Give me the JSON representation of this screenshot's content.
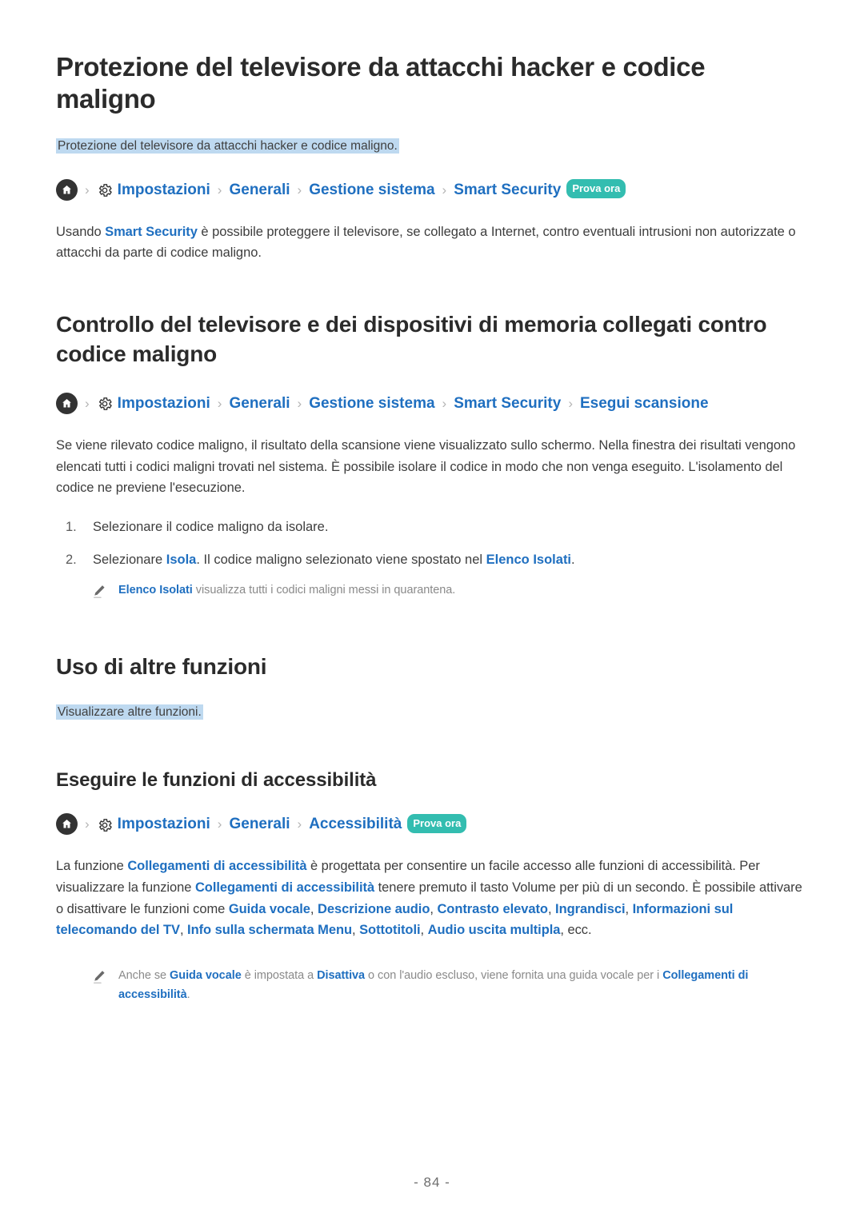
{
  "document": {
    "page_number": "- 84 -"
  },
  "icons": {
    "home": "home-icon",
    "gear": "gear-icon",
    "pencil": "pencil-icon",
    "separator": "›"
  },
  "colors": {
    "link": "#1f6fc0",
    "highlight": "#bed9f0",
    "badge": "#33bdb0",
    "heading": "#2b2b2b",
    "body": "#3d3d3d",
    "note": "#8a8a8a"
  },
  "labels": {
    "try_now": "Prova ora"
  },
  "sections": [
    {
      "id": "protezione",
      "title": "Protezione del televisore da attacchi hacker e codice maligno",
      "highlight": "Protezione del televisore da attacchi hacker e codice maligno.",
      "breadcrumb": {
        "items": [
          "Impostazioni",
          "Generali",
          "Gestione sistema",
          "Smart Security"
        ],
        "badge": "Prova ora"
      },
      "paragraph": {
        "before": "Usando ",
        "link": "Smart Security",
        "after": " è possibile proteggere il televisore, se collegato a Internet, contro eventuali intrusioni non autorizzate o attacchi da parte di codice maligno."
      }
    },
    {
      "id": "controllo",
      "title": "Controllo del televisore e dei dispositivi di memoria collegati contro codice maligno",
      "breadcrumb": {
        "items": [
          "Impostazioni",
          "Generali",
          "Gestione sistema",
          "Smart Security",
          "Esegui scansione"
        ],
        "badge": ""
      },
      "paragraph": "Se viene rilevato codice maligno, il risultato della scansione viene visualizzato sullo schermo. Nella finestra dei risultati vengono elencati tutti i codici maligni trovati nel sistema. È possibile isolare il codice in modo che non venga eseguito. L'isolamento del codice ne previene l'esecuzione.",
      "steps": [
        {
          "marker": "1.",
          "parts": [
            {
              "type": "text",
              "value": "Selezionare il codice maligno da isolare."
            }
          ]
        },
        {
          "marker": "2.",
          "parts": [
            {
              "type": "text",
              "value": "Selezionare "
            },
            {
              "type": "link",
              "value": "Isola"
            },
            {
              "type": "text",
              "value": ". Il codice maligno selezionato viene spostato nel "
            },
            {
              "type": "link",
              "value": "Elenco Isolati"
            },
            {
              "type": "text",
              "value": "."
            }
          ]
        }
      ],
      "note": {
        "parts": [
          {
            "type": "link",
            "value": "Elenco Isolati"
          },
          {
            "type": "text",
            "value": " visualizza tutti i codici maligni messi in quarantena."
          }
        ]
      }
    },
    {
      "id": "uso-altre-funzioni",
      "title": "Uso di altre funzioni",
      "highlight": "Visualizzare altre funzioni."
    },
    {
      "id": "accessibilita",
      "title": "Eseguire le funzioni di accessibilità",
      "breadcrumb": {
        "items": [
          "Impostazioni",
          "Generali",
          "Accessibilità"
        ],
        "badge": "Prova ora"
      },
      "paragraph_parts": [
        {
          "type": "text",
          "value": "La funzione "
        },
        {
          "type": "link",
          "value": "Collegamenti di accessibilità"
        },
        {
          "type": "text",
          "value": " è progettata per consentire un facile accesso alle funzioni di accessibilità. Per visualizzare la funzione "
        },
        {
          "type": "link",
          "value": "Collegamenti di accessibilità"
        },
        {
          "type": "text",
          "value": " tenere premuto il tasto Volume per più di un secondo. È possibile attivare o disattivare le funzioni come "
        },
        {
          "type": "link",
          "value": "Guida vocale"
        },
        {
          "type": "text",
          "value": ", "
        },
        {
          "type": "link",
          "value": "Descrizione audio"
        },
        {
          "type": "text",
          "value": ", "
        },
        {
          "type": "link",
          "value": "Contrasto elevato"
        },
        {
          "type": "text",
          "value": ", "
        },
        {
          "type": "link",
          "value": "Ingrandisci"
        },
        {
          "type": "text",
          "value": ", "
        },
        {
          "type": "link",
          "value": "Informazioni sul telecomando del TV"
        },
        {
          "type": "text",
          "value": ", "
        },
        {
          "type": "link",
          "value": "Info sulla schermata Menu"
        },
        {
          "type": "text",
          "value": ", "
        },
        {
          "type": "link",
          "value": "Sottotitoli"
        },
        {
          "type": "text",
          "value": ", "
        },
        {
          "type": "link",
          "value": "Audio uscita multipla"
        },
        {
          "type": "text",
          "value": ", ecc."
        }
      ],
      "note": {
        "parts": [
          {
            "type": "text",
            "value": "Anche se "
          },
          {
            "type": "link",
            "value": "Guida vocale"
          },
          {
            "type": "text",
            "value": " è impostata a "
          },
          {
            "type": "link",
            "value": "Disattiva"
          },
          {
            "type": "text",
            "value": " o con l'audio escluso, viene fornita una guida vocale per i "
          },
          {
            "type": "link",
            "value": "Collegamenti di accessibilità"
          },
          {
            "type": "text",
            "value": "."
          }
        ]
      }
    }
  ]
}
